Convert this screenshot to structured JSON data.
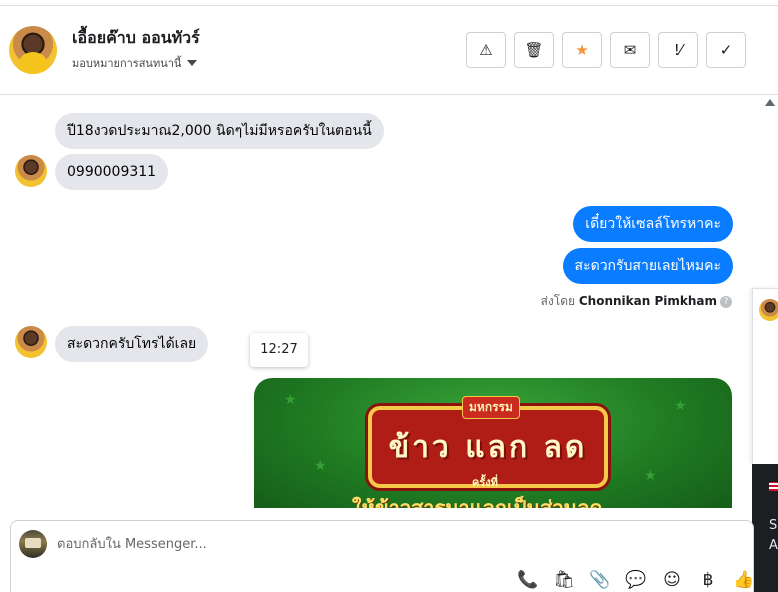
{
  "header": {
    "contact_name": "เอื้อยค๊าบ ออนทัวร์",
    "assign_label": "มอบหมายการสนทนานี้",
    "actions": [
      {
        "name": "spam-button",
        "glyph": "⚠"
      },
      {
        "name": "delete-button",
        "glyph": "🗑"
      },
      {
        "name": "star-button",
        "glyph": "★"
      },
      {
        "name": "mark-unread-button",
        "glyph": "✉"
      },
      {
        "name": "follow-up-button",
        "glyph": "!⁄"
      },
      {
        "name": "mark-done-button",
        "glyph": "✓"
      }
    ],
    "star_color": "#f7923b"
  },
  "messages": {
    "in1": "ปี18งวดประมาณ2,000 นิดๆไม่มีหรอครับในตอนนี้",
    "in2": "0990009311",
    "out1": "เดี๋ยวให้เซลล์โทรหาคะ",
    "out2": "สะดวกรับสายเลยไหมคะ",
    "sent_by_prefix": "ส่งโดย",
    "sent_by_name": "Chonnikan Pimkham",
    "in3": "สะดวกครับโทรได้เลย",
    "timestamp_tooltip": "12:27",
    "outgoing_color": "#0a7cff",
    "incoming_color": "#e4e6eb"
  },
  "promo_image": {
    "small_label": "มหกรรม",
    "big_label": "ข้าว แลก ลด",
    "sub_label": "ครั้งที่",
    "line2": "ให้ข้าวสารมาแลกเป็นส่วนลด"
  },
  "side_panel": {
    "text1": "S",
    "text2": "A"
  },
  "composer": {
    "placeholder": "ตอบกลับใน Messenger...",
    "tools": [
      {
        "name": "call-icon",
        "glyph": "📞"
      },
      {
        "name": "shop-bag-icon",
        "glyph": "🛍"
      },
      {
        "name": "attach-icon",
        "glyph": "📎"
      },
      {
        "name": "saved-replies-icon",
        "glyph": "💬"
      },
      {
        "name": "emoji-icon",
        "glyph": "☺"
      },
      {
        "name": "baht-icon",
        "glyph": "฿"
      },
      {
        "name": "like-icon",
        "glyph": "👍"
      }
    ]
  }
}
